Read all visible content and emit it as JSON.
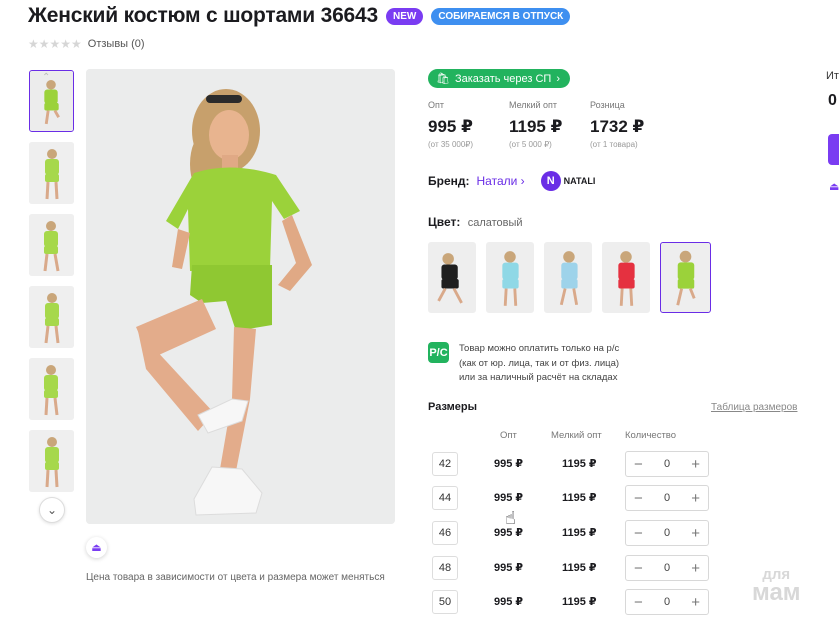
{
  "product": {
    "title": "Женский костюм с шортами 36643",
    "badges": {
      "new": "NEW",
      "vacation": "СОБИРАЕМСЯ В ОТПУСК"
    },
    "reviews": "Отзывы (0)",
    "rating_stars": 0
  },
  "gallery": {
    "thumbnail_count": 6,
    "price_note": "Цена товара в зависимости от цвета и размера может меняться"
  },
  "order": {
    "sp_button": "Заказать через СП"
  },
  "prices": [
    {
      "label": "Опт",
      "value": "995 ₽",
      "sub": "(от 35 000₽)"
    },
    {
      "label": "Мелкий опт",
      "value": "1195 ₽",
      "sub": "(от 5 000 ₽)"
    },
    {
      "label": "Розница",
      "value": "1732 ₽",
      "sub": "(от 1 товара)"
    }
  ],
  "brand": {
    "label": "Бренд:",
    "name": "Натали",
    "logo_text": "NATALI"
  },
  "color": {
    "label": "Цвет:",
    "value": "салатовый",
    "options": [
      {
        "name": "черный",
        "color": "#1f1f1f"
      },
      {
        "name": "голубой",
        "color": "#8fd8e6"
      },
      {
        "name": "голубой-2",
        "color": "#9ed3ea"
      },
      {
        "name": "красный",
        "color": "#e53140"
      },
      {
        "name": "салатовый",
        "color": "#9bd23a"
      }
    ],
    "selected_index": 4
  },
  "payment": {
    "icon_text": "Р/С",
    "line1": "Товар можно оплатить только на р/с",
    "line2": "(как от юр. лица, так и от физ. лица)",
    "line3": "или за наличный расчёт на складах"
  },
  "sizes": {
    "heading": "Размеры",
    "table_link": "Таблица размеров",
    "col_opt": "Опт",
    "col_small": "Мелкий опт",
    "col_qty": "Количество",
    "rows": [
      {
        "size": "42",
        "opt": "995 ₽",
        "small": "1195 ₽",
        "qty": "0"
      },
      {
        "size": "44",
        "opt": "995 ₽",
        "small": "1195 ₽",
        "qty": "0"
      },
      {
        "size": "46",
        "opt": "995 ₽",
        "small": "1195 ₽",
        "qty": "0"
      },
      {
        "size": "48",
        "opt": "995 ₽",
        "small": "1195 ₽",
        "qty": "0"
      },
      {
        "size": "50",
        "opt": "995 ₽",
        "small": "1195 ₽",
        "qty": "0"
      }
    ]
  },
  "sidebar_cut": {
    "label": "Ит",
    "value": "0"
  },
  "watermark": {
    "line1": "для",
    "line2": "мам"
  },
  "colors": {
    "accent": "#7a3cf2",
    "green": "#22b35e",
    "suit": "#9bd23a"
  }
}
